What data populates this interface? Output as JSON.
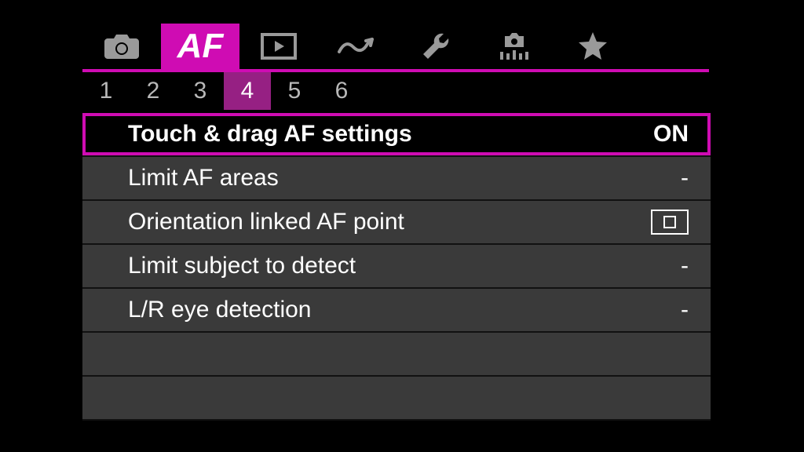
{
  "tabs": {
    "active_index": 1,
    "items": [
      {
        "name": "camera-icon"
      },
      {
        "name": "af-icon",
        "label": "AF"
      },
      {
        "name": "playback-icon"
      },
      {
        "name": "wireless-icon"
      },
      {
        "name": "wrench-icon"
      },
      {
        "name": "pixelshift-icon"
      },
      {
        "name": "star-icon"
      }
    ]
  },
  "subtabs": {
    "items": [
      "1",
      "2",
      "3",
      "4",
      "5",
      "6"
    ],
    "active_index": 3
  },
  "rows": [
    {
      "label": "Touch & drag AF settings",
      "value": "ON",
      "selected": true,
      "value_type": "text"
    },
    {
      "label": "Limit AF areas",
      "value": "-",
      "value_type": "text"
    },
    {
      "label": "Orientation linked AF point",
      "value": "",
      "value_type": "orient-icon"
    },
    {
      "label": "Limit subject to detect",
      "value": "-",
      "value_type": "text"
    },
    {
      "label": "L/R eye detection",
      "value": "-",
      "value_type": "text"
    },
    {
      "label": "",
      "value": "",
      "value_type": "empty"
    },
    {
      "label": "",
      "value": "",
      "value_type": "empty"
    }
  ],
  "colors": {
    "accent": "#cf0cb3"
  }
}
